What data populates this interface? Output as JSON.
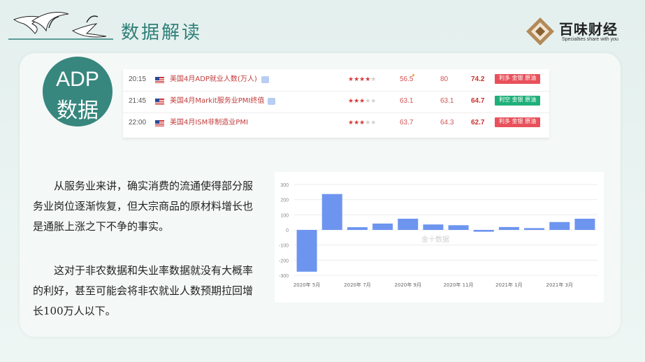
{
  "header": {
    "title": "数据解读",
    "logo": {
      "name": "百味财经",
      "slogan": "Specialties share with you"
    }
  },
  "badge": {
    "line1": "ADP",
    "line2": "数据"
  },
  "calendar": {
    "rows": [
      {
        "time": "20:15",
        "name": "美国4月ADP就业人数(万人)",
        "stars": 4,
        "previous": "56.5",
        "forecast": "80",
        "actual": "74.2",
        "impact": "利多 金银 原油",
        "impact_color": "#e8515b"
      },
      {
        "time": "21:45",
        "name": "美国4月Markit服务业PMI终值",
        "stars": 3,
        "previous": "63.1",
        "forecast": "63.1",
        "actual": "64.7",
        "impact": "利空 金银 原油",
        "impact_color": "#1fb07a"
      },
      {
        "time": "22:00",
        "name": "美国4月ISM非制造业PMI",
        "stars": 3,
        "previous": "63.7",
        "forecast": "64.3",
        "actual": "62.7",
        "impact": "利多 金银 原油",
        "impact_color": "#e8515b"
      }
    ]
  },
  "body_text": {
    "para1": "从服务业来讲，确实消费的流通使得部分服务业岗位逐渐恢复，但大宗商品的原材料增长也是通胀上涨之下不争的事实。",
    "para2": "这对于非农数据和失业率数据就没有大概率的利好，甚至可能会将非农就业人数预期拉回增长100万人以下。"
  },
  "chart_data": {
    "type": "bar",
    "categories": [
      "2020年5月",
      "2020年6月",
      "2020年7月",
      "2020年8月",
      "2020年9月",
      "2020年10月",
      "2020年11月",
      "2020年12月",
      "2021年1月",
      "2021年2月",
      "2021年3月",
      "2021年4月"
    ],
    "tick_labels": [
      "2020年 5月",
      "2020年 7月",
      "2020年 9月",
      "2020年 11月",
      "2021年 1月",
      "2021年 3月"
    ],
    "values": [
      -276,
      237,
      18,
      42,
      74,
      36,
      31,
      -12,
      19,
      12,
      52,
      74
    ],
    "ylim": [
      -300,
      300
    ],
    "yticks": [
      300,
      200,
      100,
      0,
      -100,
      -200,
      -300
    ],
    "grid": true,
    "bar_color": "#6d95ef",
    "watermark": "金十数据"
  }
}
